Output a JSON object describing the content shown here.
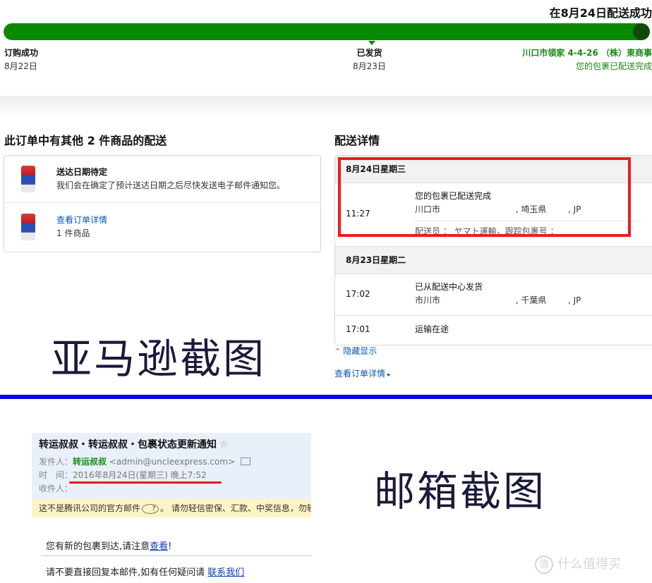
{
  "tracking": {
    "status_title": "在8月24日配送成功",
    "progress": 1.0,
    "milestones": {
      "ordered": {
        "label": "订购成功",
        "date": "8月22日"
      },
      "shipped": {
        "label": "已发货",
        "date": "8月23日"
      },
      "delivered": {
        "address": "川口市領家 4-4-26 （株）東商事",
        "status": "您的包裹已配送完成"
      }
    }
  },
  "other_items": {
    "title": "此订单中有其他 2 件商品的配送",
    "rows": [
      {
        "bold": "送达日期待定",
        "text": "我们会在确定了预计送达日期之后尽快发送电子邮件通知您。"
      },
      {
        "link": "查看订单详情",
        "text": "1 件商品"
      }
    ]
  },
  "details": {
    "title": "配送详情",
    "days": [
      {
        "header": "8月24日星期三",
        "events": [
          {
            "time": "11:27",
            "desc": "您的包裹已配送完成",
            "location": "川口市                            , 埼玉県        , JP",
            "carrier": "配送员 ： ヤマト運輸，跟踪包裹号 ："
          }
        ]
      },
      {
        "header": "8月23日星期二",
        "events": [
          {
            "time": "17:02",
            "desc": "已从配送中心发货",
            "location": "市川市                            , 千葉県        , JP"
          },
          {
            "time": "17:01",
            "desc": "运输在途"
          }
        ]
      }
    ],
    "hide_link": "隐藏显示",
    "order_link": "查看订单详情"
  },
  "captions": {
    "amazon": "亚马逊截图",
    "mail": "邮箱截图"
  },
  "email": {
    "subject": "转运叔叔・转运叔叔・包裹状态更新通知",
    "from_label": "发件人：",
    "from_name": "转运叔叔",
    "from_addr": "<admin@uncleexpress.com>",
    "time_label": "时　间：",
    "time_value": "2016年8月24日(星期三) 晚上7:52",
    "to_label": "收件人：",
    "warning": "这不是腾讯公司的官方邮件",
    "warning_tail": "。  请勿轻信密保、汇款、中奖信息，勿轻",
    "body1_prefix": "您有新的包裹到达,请注意",
    "body1_link": "查看",
    "body1_suffix": "!",
    "body2_prefix": "请不要直接回复本邮件,如有任何疑问请 ",
    "body2_link": "联系我们"
  },
  "watermark": {
    "icon": "值",
    "text": "什么值得买"
  },
  "colors": {
    "progress_green": "#0a8a00",
    "delivered_green": "#1a8a1a",
    "link_blue": "#0a58b5",
    "highlight_red": "#ee1c1c",
    "divider_blue": "#0000e8"
  }
}
